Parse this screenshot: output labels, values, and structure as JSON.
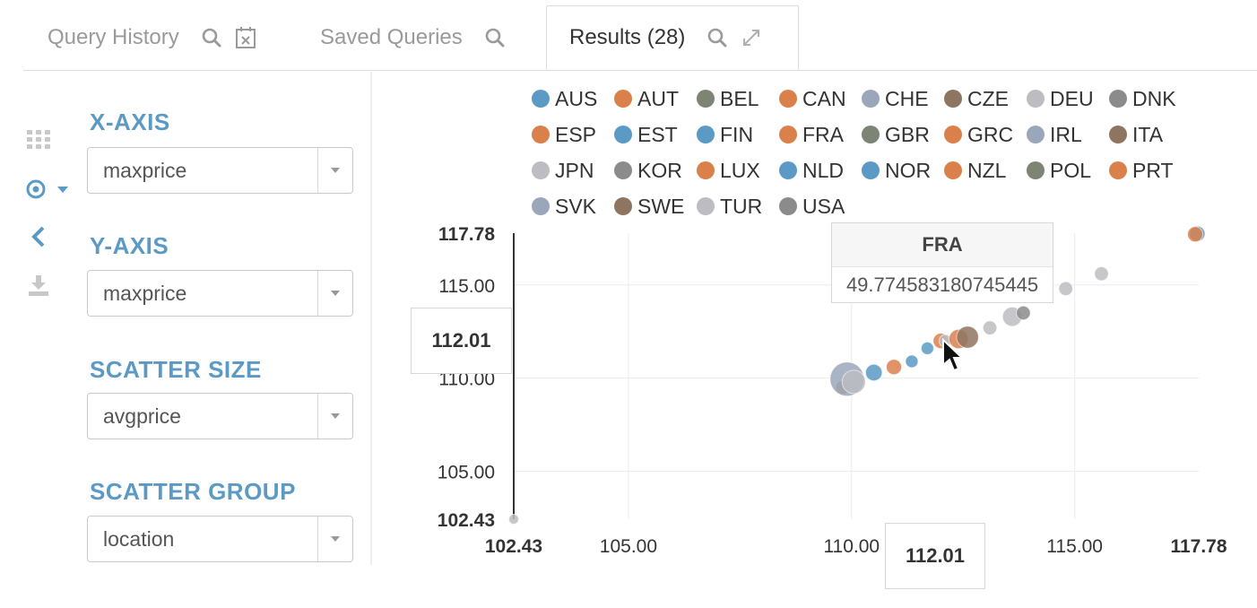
{
  "tabs": [
    {
      "label": "Query History",
      "icons": [
        "search-icon",
        "calendar-remove-icon"
      ],
      "active": false
    },
    {
      "label": "Saved Queries",
      "icons": [
        "search-icon"
      ],
      "active": false
    },
    {
      "label": "Results (28)",
      "icons": [
        "search-icon",
        "expand-icon"
      ],
      "active": true
    }
  ],
  "sidebar": {
    "icons": [
      "grid-icon",
      "scatter-chart-icon",
      "collapse-left-icon",
      "download-icon"
    ],
    "sections": [
      {
        "title": "X-AXIS",
        "value": "maxprice"
      },
      {
        "title": "Y-AXIS",
        "value": "maxprice"
      },
      {
        "title": "SCATTER SIZE",
        "value": "avgprice"
      },
      {
        "title": "SCATTER GROUP",
        "value": "location"
      }
    ]
  },
  "colors": {
    "accent": "#5b9ac4",
    "blue": "#5b9ac4",
    "orange": "#d9804b",
    "gray_green": "#7c8574",
    "slate": "#9aa7bb",
    "brown": "#8e7561",
    "light_gray": "#bcbcc2",
    "dark_gray": "#8b8b8b"
  },
  "legend": [
    {
      "name": "AUS",
      "color": "#5b9ac4"
    },
    {
      "name": "AUT",
      "color": "#d9804b"
    },
    {
      "name": "BEL",
      "color": "#7c8574"
    },
    {
      "name": "CAN",
      "color": "#d9804b"
    },
    {
      "name": "CHE",
      "color": "#9aa7bb"
    },
    {
      "name": "CZE",
      "color": "#8e7561"
    },
    {
      "name": "DEU",
      "color": "#bcbcc2"
    },
    {
      "name": "DNK",
      "color": "#8b8b8b"
    },
    {
      "name": "ESP",
      "color": "#d9804b"
    },
    {
      "name": "EST",
      "color": "#5b9ac4"
    },
    {
      "name": "FIN",
      "color": "#5b9ac4"
    },
    {
      "name": "FRA",
      "color": "#d9804b"
    },
    {
      "name": "GBR",
      "color": "#7c8574"
    },
    {
      "name": "GRC",
      "color": "#d9804b"
    },
    {
      "name": "IRL",
      "color": "#9aa7bb"
    },
    {
      "name": "ITA",
      "color": "#8e7561"
    },
    {
      "name": "JPN",
      "color": "#bcbcc2"
    },
    {
      "name": "KOR",
      "color": "#8b8b8b"
    },
    {
      "name": "LUX",
      "color": "#d9804b"
    },
    {
      "name": "NLD",
      "color": "#5b9ac4"
    },
    {
      "name": "NOR",
      "color": "#5b9ac4"
    },
    {
      "name": "NZL",
      "color": "#d9804b"
    },
    {
      "name": "POL",
      "color": "#7c8574"
    },
    {
      "name": "PRT",
      "color": "#d9804b"
    },
    {
      "name": "SVK",
      "color": "#9aa7bb"
    },
    {
      "name": "SWE",
      "color": "#8e7561"
    },
    {
      "name": "TUR",
      "color": "#bcbcc2"
    },
    {
      "name": "USA",
      "color": "#8b8b8b"
    }
  ],
  "chart_data": {
    "type": "scatter",
    "xlim": [
      102.43,
      117.78
    ],
    "ylim": [
      102.43,
      117.78
    ],
    "x_ticks": [
      "102.43",
      "105.00",
      "110.00",
      "115.00",
      "117.78"
    ],
    "y_ticks": [
      "117.78",
      "115.00",
      "110.00",
      "105.00",
      "102.43"
    ],
    "grid": true,
    "legend_position": "top",
    "crosshair_x_label": "112.01",
    "crosshair_y_label": "112.01",
    "tooltip": {
      "title": "FRA",
      "value": "49.774583180745445"
    },
    "points": [
      {
        "x": 102.43,
        "y": 102.43,
        "size": 0.1,
        "color": "#bcbcc2"
      },
      {
        "x": 109.8,
        "y": 109.5,
        "size": 0.25,
        "color": "#d9804b"
      },
      {
        "x": 109.9,
        "y": 109.95,
        "size": 1.0,
        "color": "#9aa7bb"
      },
      {
        "x": 110.05,
        "y": 109.8,
        "size": 0.6,
        "color": "#bcbcc2"
      },
      {
        "x": 110.5,
        "y": 110.3,
        "size": 0.35,
        "color": "#5b9ac4"
      },
      {
        "x": 110.95,
        "y": 110.6,
        "size": 0.3,
        "color": "#d9804b"
      },
      {
        "x": 111.35,
        "y": 110.9,
        "size": 0.2,
        "color": "#5b9ac4"
      },
      {
        "x": 111.7,
        "y": 111.6,
        "size": 0.2,
        "color": "#5b9ac4"
      },
      {
        "x": 112.0,
        "y": 112.0,
        "size": 0.3,
        "color": "#d9804b"
      },
      {
        "x": 112.1,
        "y": 112.0,
        "size": 0.2,
        "color": "#bcbcc2"
      },
      {
        "x": 112.4,
        "y": 112.1,
        "size": 0.45,
        "color": "#d9804b"
      },
      {
        "x": 112.6,
        "y": 112.2,
        "size": 0.55,
        "color": "#8e7561"
      },
      {
        "x": 113.1,
        "y": 112.7,
        "size": 0.25,
        "color": "#bcbcc2"
      },
      {
        "x": 113.6,
        "y": 113.3,
        "size": 0.45,
        "color": "#bcbcc2"
      },
      {
        "x": 113.85,
        "y": 113.5,
        "size": 0.25,
        "color": "#8b8b8b"
      },
      {
        "x": 114.8,
        "y": 114.8,
        "size": 0.25,
        "color": "#bcbcc2"
      },
      {
        "x": 115.6,
        "y": 115.6,
        "size": 0.25,
        "color": "#bcbcc2"
      },
      {
        "x": 117.75,
        "y": 117.75,
        "size": 0.3,
        "color": "#5b9ac4"
      },
      {
        "x": 117.7,
        "y": 117.72,
        "size": 0.3,
        "color": "#d9804b"
      }
    ]
  }
}
